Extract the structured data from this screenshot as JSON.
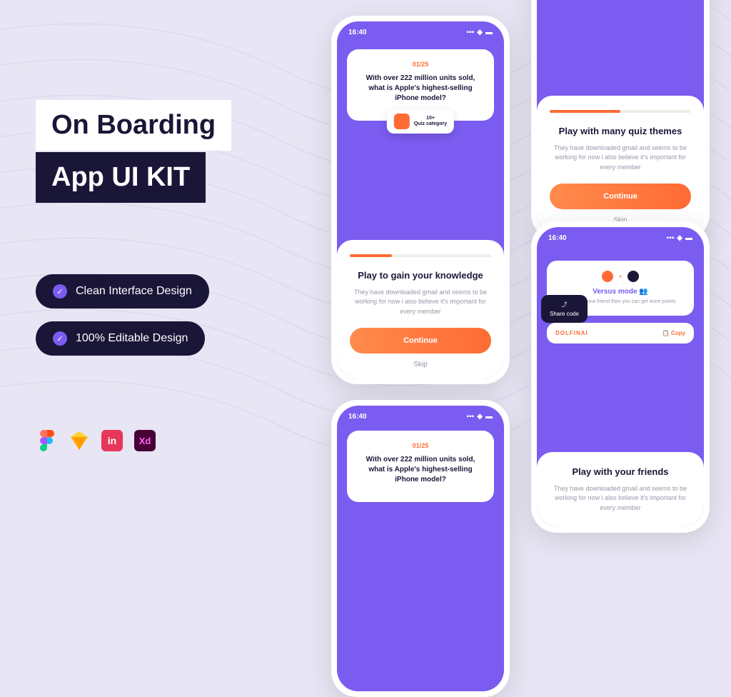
{
  "title": {
    "line1": "On Boarding",
    "line2": "App UI KIT"
  },
  "features": [
    "Clean Interface Design",
    "100% Editable Design"
  ],
  "tools": [
    "Figma",
    "Sketch",
    "InVision",
    "XD"
  ],
  "phone": {
    "time": "16:40",
    "quiz": {
      "counter": "01/25",
      "question": "With over 222 million units sold, what is Apple's highest-selling iPhone model?",
      "badge_count": "10+",
      "badge_label": "Quiz category"
    },
    "onboard1": {
      "title": "Play to gain your knowledge",
      "desc": "They have downloaded gmail and seems to be working for now i also believe it's important for every member",
      "button": "Continue",
      "skip": "Skip",
      "progress": 30
    },
    "onboard2": {
      "title": "Play with many quiz themes",
      "desc": "They have downloaded gmail and seems to be working for now i also believe it's important for every member",
      "button": "Continue",
      "skip": "Skip",
      "progress": 50
    },
    "versus": {
      "title": "Versus mode",
      "desc": "play with your friend then you can get more points",
      "share_label": "Share code",
      "code": "DOLFINAI",
      "copy": "Copy"
    },
    "onboard3": {
      "title": "Play with your friends",
      "desc": "They have downloaded gmail and seems to be working for now i also believe it's important for every member"
    }
  }
}
